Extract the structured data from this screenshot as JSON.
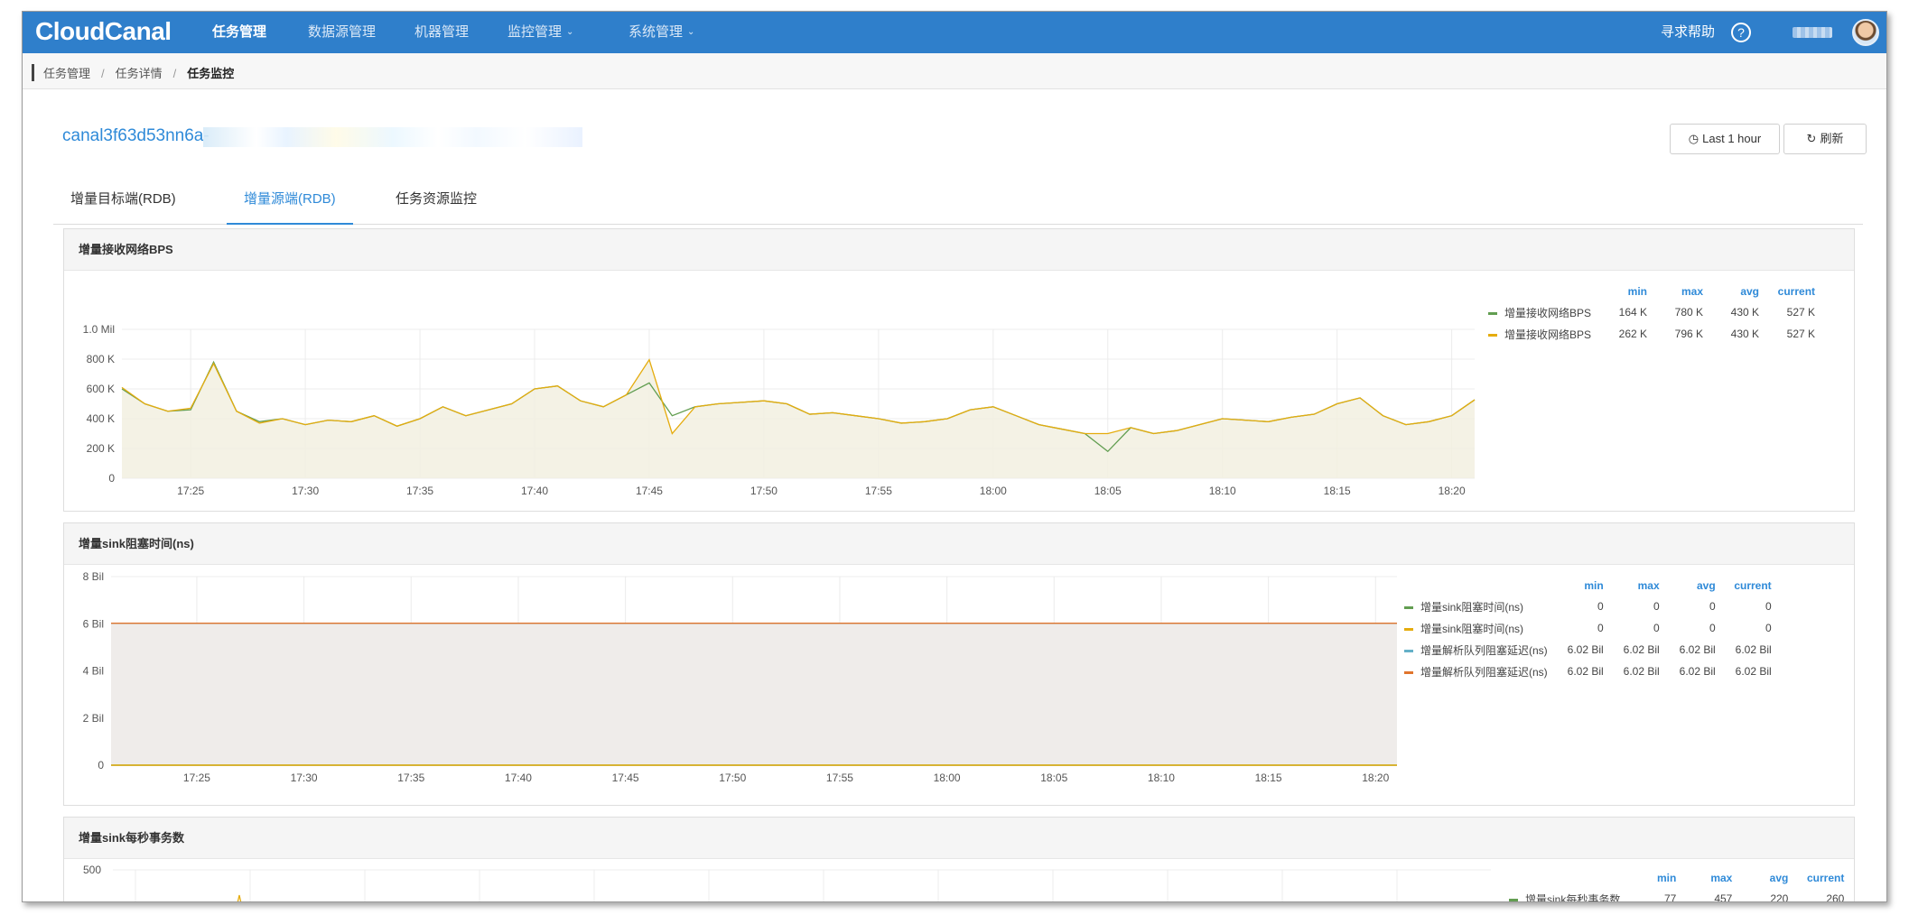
{
  "nav": {
    "logo": "CloudCanal",
    "items": [
      {
        "label": "任务管理",
        "active": true,
        "dropdown": false
      },
      {
        "label": "数据源管理",
        "active": false,
        "dropdown": false
      },
      {
        "label": "机器管理",
        "active": false,
        "dropdown": false
      },
      {
        "label": "监控管理",
        "active": false,
        "dropdown": true
      },
      {
        "label": "系统管理",
        "active": false,
        "dropdown": true
      }
    ],
    "help": "寻求帮助",
    "help_icon": "question-circle-icon"
  },
  "breadcrumb": [
    "任务管理",
    "任务详情",
    "任务监控"
  ],
  "task": {
    "title": "canal3f63d53nn6a-"
  },
  "toolbar": {
    "range_label": "Last 1 hour",
    "range_icon": "clock-icon",
    "refresh_label": "刷新",
    "refresh_icon": "refresh-icon"
  },
  "tabs": [
    {
      "label": "增量目标端(RDB)",
      "active": false
    },
    {
      "label": "增量源端(RDB)",
      "active": true
    },
    {
      "label": "任务资源监控",
      "active": false
    }
  ],
  "colors": {
    "green": "#629e51",
    "yellow": "#e5ac0e",
    "blue": "#64b0c8",
    "orange": "#e0752d",
    "fill": "#f2f0e1",
    "fill_gray": "#efecea",
    "accent": "#2f8ad8"
  },
  "chart_data": [
    {
      "type": "line",
      "title": "增量接收网络BPS",
      "y_ticks": [
        "0",
        "200 K",
        "400 K",
        "600 K",
        "800 K",
        "1.0 Mil"
      ],
      "ylim": [
        0,
        1000000
      ],
      "x_ticks": [
        "17:25",
        "17:30",
        "17:35",
        "17:40",
        "17:45",
        "17:50",
        "17:55",
        "18:00",
        "18:05",
        "18:10",
        "18:15",
        "18:20"
      ],
      "xlim": [
        "17:22",
        "18:21"
      ],
      "legend_headers": [
        "min",
        "max",
        "avg",
        "current"
      ],
      "series": [
        {
          "name": "增量接收网络BPS",
          "color": "#629e51",
          "min": "164 K",
          "max": "780 K",
          "avg": "430 K",
          "current": "527 K",
          "x_times": [
            "17:22",
            "17:23",
            "17:24",
            "17:25",
            "17:26",
            "17:27",
            "17:28",
            "17:29",
            "17:30",
            "17:31",
            "17:32",
            "17:33",
            "17:34",
            "17:35",
            "17:36",
            "17:37",
            "17:38",
            "17:39",
            "17:40",
            "17:41",
            "17:42",
            "17:43",
            "17:44",
            "17:45",
            "17:46",
            "17:47",
            "17:48",
            "17:49",
            "17:50",
            "17:51",
            "17:52",
            "17:53",
            "17:54",
            "17:55",
            "17:56",
            "17:57",
            "17:58",
            "17:59",
            "18:00",
            "18:01",
            "18:02",
            "18:03",
            "18:04",
            "18:05",
            "18:06",
            "18:07",
            "18:08",
            "18:09",
            "18:10",
            "18:11",
            "18:12",
            "18:13",
            "18:14",
            "18:15",
            "18:16",
            "18:17",
            "18:18",
            "18:19",
            "18:20",
            "18:21"
          ],
          "values": [
            600000,
            500000,
            450000,
            460000,
            780000,
            450000,
            380000,
            400000,
            360000,
            390000,
            380000,
            420000,
            350000,
            400000,
            480000,
            420000,
            460000,
            500000,
            600000,
            620000,
            520000,
            480000,
            560000,
            640000,
            420000,
            480000,
            500000,
            510000,
            520000,
            500000,
            430000,
            440000,
            420000,
            400000,
            370000,
            380000,
            400000,
            460000,
            480000,
            420000,
            360000,
            330000,
            300000,
            180000,
            340000,
            300000,
            320000,
            360000,
            400000,
            390000,
            380000,
            410000,
            430000,
            500000,
            540000,
            420000,
            360000,
            380000,
            420000,
            527000
          ]
        },
        {
          "name": "增量接收网络BPS",
          "color": "#e5ac0e",
          "min": "262 K",
          "max": "796 K",
          "avg": "430 K",
          "current": "527 K",
          "x_times": [
            "17:22",
            "17:23",
            "17:24",
            "17:25",
            "17:26",
            "17:27",
            "17:28",
            "17:29",
            "17:30",
            "17:31",
            "17:32",
            "17:33",
            "17:34",
            "17:35",
            "17:36",
            "17:37",
            "17:38",
            "17:39",
            "17:40",
            "17:41",
            "17:42",
            "17:43",
            "17:44",
            "17:45",
            "17:46",
            "17:47",
            "17:48",
            "17:49",
            "17:50",
            "17:51",
            "17:52",
            "17:53",
            "17:54",
            "17:55",
            "17:56",
            "17:57",
            "17:58",
            "17:59",
            "18:00",
            "18:01",
            "18:02",
            "18:03",
            "18:04",
            "18:05",
            "18:06",
            "18:07",
            "18:08",
            "18:09",
            "18:10",
            "18:11",
            "18:12",
            "18:13",
            "18:14",
            "18:15",
            "18:16",
            "18:17",
            "18:18",
            "18:19",
            "18:20",
            "18:21"
          ],
          "values": [
            610000,
            500000,
            450000,
            470000,
            770000,
            450000,
            370000,
            400000,
            360000,
            390000,
            380000,
            420000,
            350000,
            400000,
            480000,
            420000,
            460000,
            500000,
            600000,
            620000,
            520000,
            480000,
            560000,
            796000,
            300000,
            480000,
            500000,
            510000,
            520000,
            500000,
            430000,
            440000,
            420000,
            400000,
            370000,
            380000,
            400000,
            460000,
            480000,
            420000,
            360000,
            330000,
            300000,
            300000,
            340000,
            300000,
            320000,
            360000,
            400000,
            390000,
            380000,
            410000,
            430000,
            500000,
            540000,
            420000,
            360000,
            380000,
            420000,
            527000
          ]
        }
      ]
    },
    {
      "type": "area",
      "title": "增量sink阻塞时间(ns)",
      "y_ticks": [
        "0",
        "2 Bil",
        "4 Bil",
        "6 Bil",
        "8 Bil"
      ],
      "ylim": [
        0,
        8000000000
      ],
      "x_ticks": [
        "17:25",
        "17:30",
        "17:35",
        "17:40",
        "17:45",
        "17:50",
        "17:55",
        "18:00",
        "18:05",
        "18:10",
        "18:15",
        "18:20"
      ],
      "xlim": [
        "17:21",
        "18:21"
      ],
      "legend_headers": [
        "min",
        "max",
        "avg",
        "current"
      ],
      "series": [
        {
          "name": "增量sink阻塞时间(ns)",
          "color": "#629e51",
          "min": "0",
          "max": "0",
          "avg": "0",
          "current": "0",
          "value": 0
        },
        {
          "name": "增量sink阻塞时间(ns)",
          "color": "#e5ac0e",
          "min": "0",
          "max": "0",
          "avg": "0",
          "current": "0",
          "value": 0
        },
        {
          "name": "增量解析队列阻塞延迟(ns)",
          "color": "#64b0c8",
          "min": "6.02 Bil",
          "max": "6.02 Bil",
          "avg": "6.02 Bil",
          "current": "6.02 Bil",
          "value": 6020000000
        },
        {
          "name": "增量解析队列阻塞延迟(ns)",
          "color": "#e0752d",
          "min": "6.02 Bil",
          "max": "6.02 Bil",
          "avg": "6.02 Bil",
          "current": "6.02 Bil",
          "value": 6020000000
        }
      ]
    },
    {
      "type": "line",
      "title": "增量sink每秒事务数",
      "y_ticks": [
        "500"
      ],
      "ylim": [
        0,
        500
      ],
      "legend_headers": [
        "min",
        "max",
        "avg",
        "current"
      ],
      "series": [
        {
          "name": "增量sink每秒事务数",
          "color": "#629e51",
          "min": "77",
          "max": "457",
          "avg": "220",
          "current": "260"
        }
      ]
    }
  ]
}
